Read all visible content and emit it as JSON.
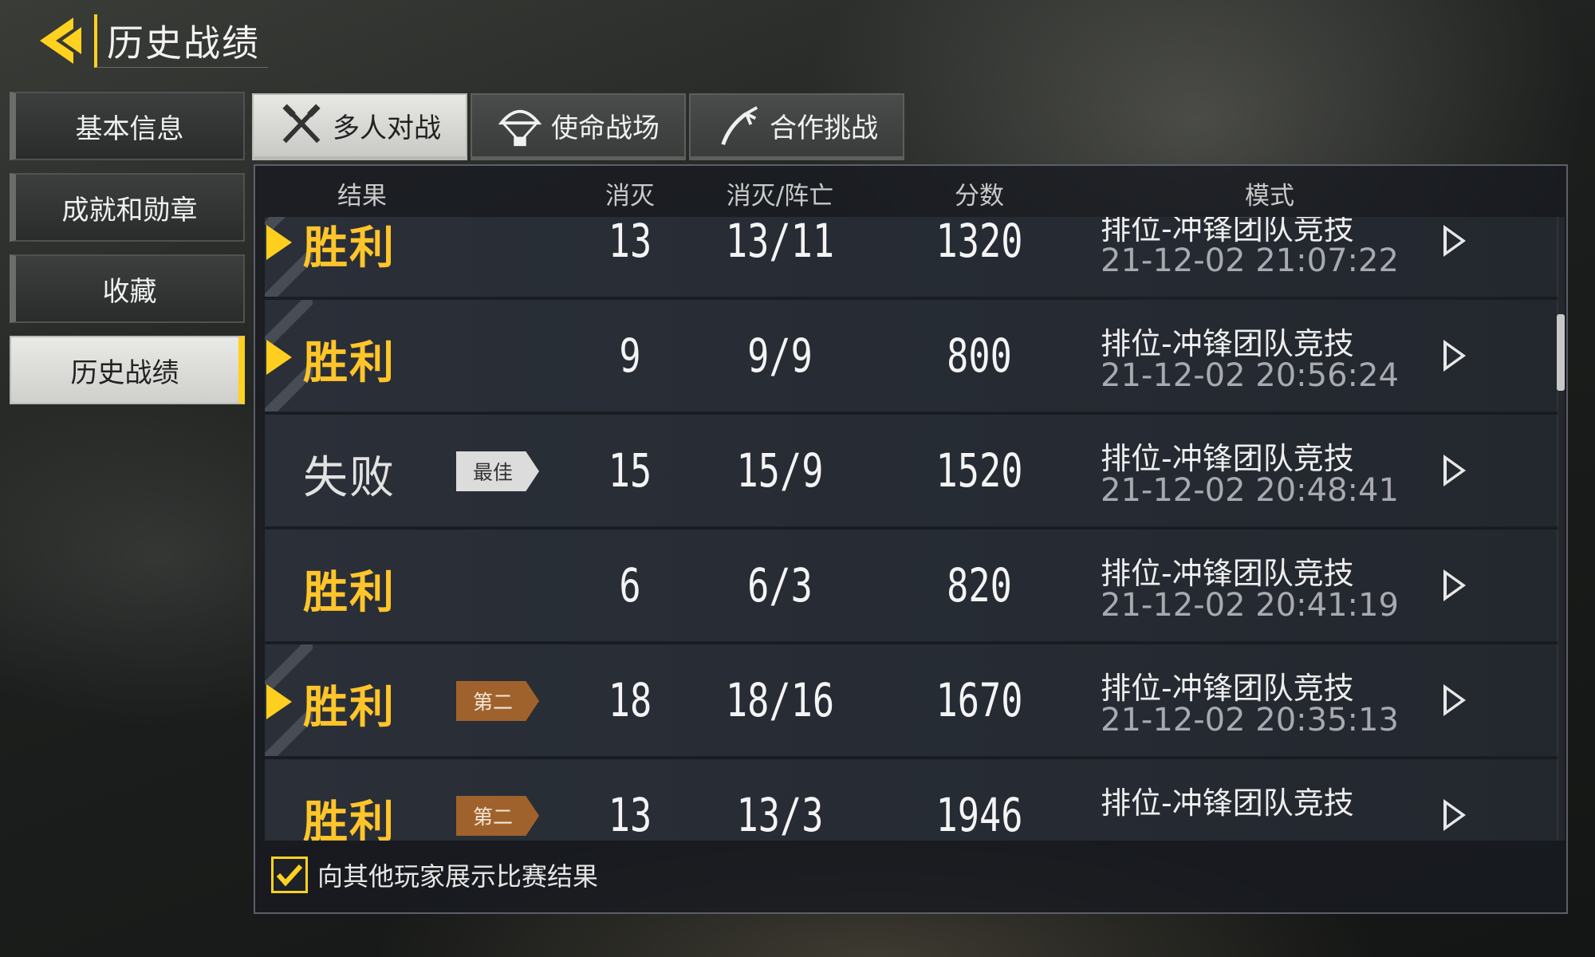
{
  "header": {
    "title": "历史战绩",
    "back_icon": "back-arrow-icon",
    "accent": "#ffd21f"
  },
  "sidebar": {
    "items": [
      {
        "label": "基本信息"
      },
      {
        "label": "成就和勋章"
      },
      {
        "label": "收藏"
      },
      {
        "label": "历史战绩",
        "active": true
      }
    ]
  },
  "tabs": [
    {
      "label": "多人对战",
      "icon": "crossed-guns-icon",
      "active": true
    },
    {
      "label": "使命战场",
      "icon": "parachute-icon"
    },
    {
      "label": "合作挑战",
      "icon": "claw-icon"
    }
  ],
  "table": {
    "headers": {
      "result": "结果",
      "kills": "消灭",
      "kd": "消灭/阵亡",
      "score": "分数",
      "mode": "模式"
    },
    "rows": [
      {
        "result": "胜利",
        "win": true,
        "marker": true,
        "badge": "",
        "kills": "13",
        "kd": "13/11",
        "score": "1320",
        "mode": "排位-冲锋团队竞技",
        "time": "21-12-02 21:07:22"
      },
      {
        "result": "胜利",
        "win": true,
        "marker": true,
        "badge": "",
        "kills": "9",
        "kd": "9/9",
        "score": "800",
        "mode": "排位-冲锋团队竞技",
        "time": "21-12-02 20:56:24"
      },
      {
        "result": "失败",
        "win": false,
        "marker": false,
        "badge": "最佳",
        "badge_type": "best",
        "kills": "15",
        "kd": "15/9",
        "score": "1520",
        "mode": "排位-冲锋团队竞技",
        "time": "21-12-02 20:48:41"
      },
      {
        "result": "胜利",
        "win": true,
        "marker": false,
        "badge": "",
        "kills": "6",
        "kd": "6/3",
        "score": "820",
        "mode": "排位-冲锋团队竞技",
        "time": "21-12-02 20:41:19"
      },
      {
        "result": "胜利",
        "win": true,
        "marker": true,
        "badge": "第二",
        "badge_type": "second",
        "kills": "18",
        "kd": "18/16",
        "score": "1670",
        "mode": "排位-冲锋团队竞技",
        "time": "21-12-02 20:35:13"
      },
      {
        "result": "胜利",
        "win": true,
        "marker": false,
        "badge": "第二",
        "badge_type": "second",
        "kills": "13",
        "kd": "13/3",
        "score": "1946",
        "mode": "排位-冲锋团队竞技",
        "time": ""
      }
    ],
    "play_icon": "play-arrow-icon"
  },
  "footer": {
    "checkbox_checked": true,
    "label": "向其他玩家展示比赛结果"
  }
}
